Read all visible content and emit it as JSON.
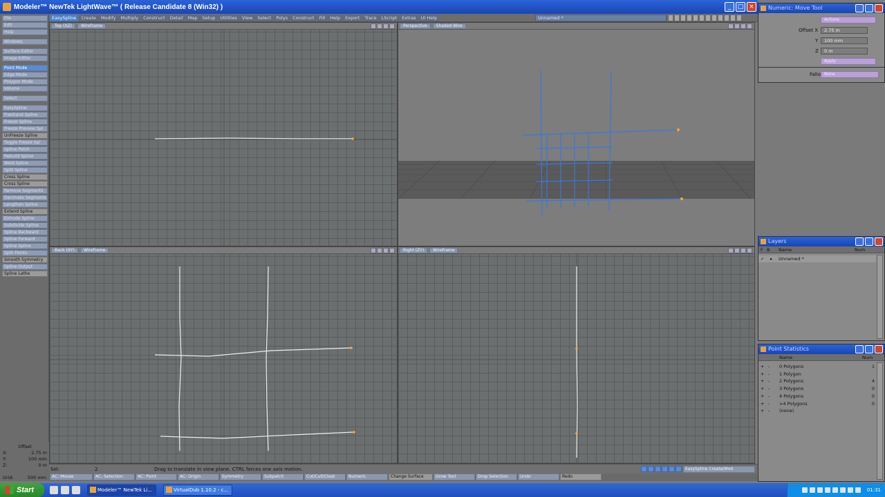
{
  "window": {
    "title": "Modeler™ NewTek LightWave™ ( Release Candidate 8 (Win32) )"
  },
  "tabs": [
    "EasySpline",
    "Create",
    "Modify",
    "Multiply",
    "Construct",
    "Detail",
    "Map",
    "Setup",
    "Utilities",
    "View",
    "Select",
    "Polys",
    "Construct",
    "Fill",
    "Help",
    "Export",
    "Trace",
    "LScript",
    "Extras",
    "UI Help"
  ],
  "active_tab": 0,
  "layer_select": "Unnamed *",
  "toolbar": {
    "file_menu": [
      "File",
      "Edit",
      "Help"
    ],
    "windows": "Windows",
    "editors": [
      "Surface Editor",
      "Image Editor"
    ],
    "modes": [
      "Point Mode",
      "Edge Mode",
      "Polygon Mode",
      "Volume"
    ],
    "select": "Select",
    "tools": [
      "EasySpline",
      "Freehand Spline",
      "Freeze Spline",
      "Freeze Preview Spl",
      "UnFreeze Spline",
      "Toggle Freeze Spl",
      "Spline Patch",
      "Rebuild Spline",
      "Weld Spline",
      "Split Spline",
      "Cross Spline",
      "Cross Spline",
      "Remove Segments",
      "Decimate Segments",
      "Lengthen Spline",
      "Extend Spline",
      "Extrude Spline",
      "Subdivide Spline",
      "Spline Backward",
      "Spline Forward",
      "Spline Spline",
      "Split Points",
      "Smooth Symmetry",
      "Spline Output",
      "Spline Lathe"
    ]
  },
  "viewports": {
    "top_left": {
      "view": "Top (XZ)",
      "mode": "Wireframe"
    },
    "top_right": {
      "view": "Perspective",
      "mode": "Shaded Wire"
    },
    "bottom_left": {
      "view": "Back (XY)",
      "mode": "Wireframe"
    },
    "bottom_right": {
      "view": "Right (ZY)",
      "mode": "Wireframe"
    }
  },
  "status": {
    "sel_label": "Sel:",
    "sel_value": "2",
    "message": "Drag to translate in view plane. CTRL forces one axis motion.",
    "tool_dropdown": "EasySpline Create/Mod",
    "buttons": [
      "AC: Mouse",
      "AC: Selection",
      "AC: Point",
      "AC: Origin",
      "Symmetry",
      "Subpatch",
      "Cut/Cull/Cleat",
      "Numeric",
      "Change Surface",
      "Grow Tool",
      "Drop Selection",
      "Undo",
      "Redo"
    ]
  },
  "offset_info": {
    "label": "Offset",
    "x_label": "X:",
    "x": "2.75 m",
    "y_label": "Y:",
    "y": "100 mm",
    "z_label": "Z:",
    "z": "0 m",
    "grid_label": "Grid:",
    "grid": "500 mm"
  },
  "numeric_panel": {
    "title": "Numeric: Move Tool",
    "actions": "Actions",
    "offset_x_label": "Offset X",
    "offset_x": "2.75 m",
    "y_label": "Y",
    "y": "100 mm",
    "z_label": "Z",
    "z": "0 m",
    "apply": "Apply",
    "falloff_label": "Falloff",
    "falloff": "None"
  },
  "layers_panel": {
    "title": "Layers",
    "cols": [
      "F",
      "B",
      "Name",
      "Num"
    ],
    "rows": [
      {
        "name": "Unnamed *"
      }
    ]
  },
  "stats_panel": {
    "title": "Point Statistics",
    "cols": [
      "Name",
      "Num"
    ],
    "rows": [
      {
        "name": "0 Polygons",
        "num": "1"
      },
      {
        "name": "1 Polygon",
        "num": ""
      },
      {
        "name": "2 Polygons",
        "num": "4"
      },
      {
        "name": "3 Polygons",
        "num": "0"
      },
      {
        "name": "4 Polygons",
        "num": "0"
      },
      {
        "name": ">4 Polygons",
        "num": "0"
      },
      {
        "name": "(none)",
        "num": ""
      }
    ]
  },
  "taskbar": {
    "start": "Start",
    "tasks": [
      "Modeler™ NewTek Li...",
      "VirtualDub 1.10.2 - c..."
    ],
    "clock": "01:31"
  }
}
